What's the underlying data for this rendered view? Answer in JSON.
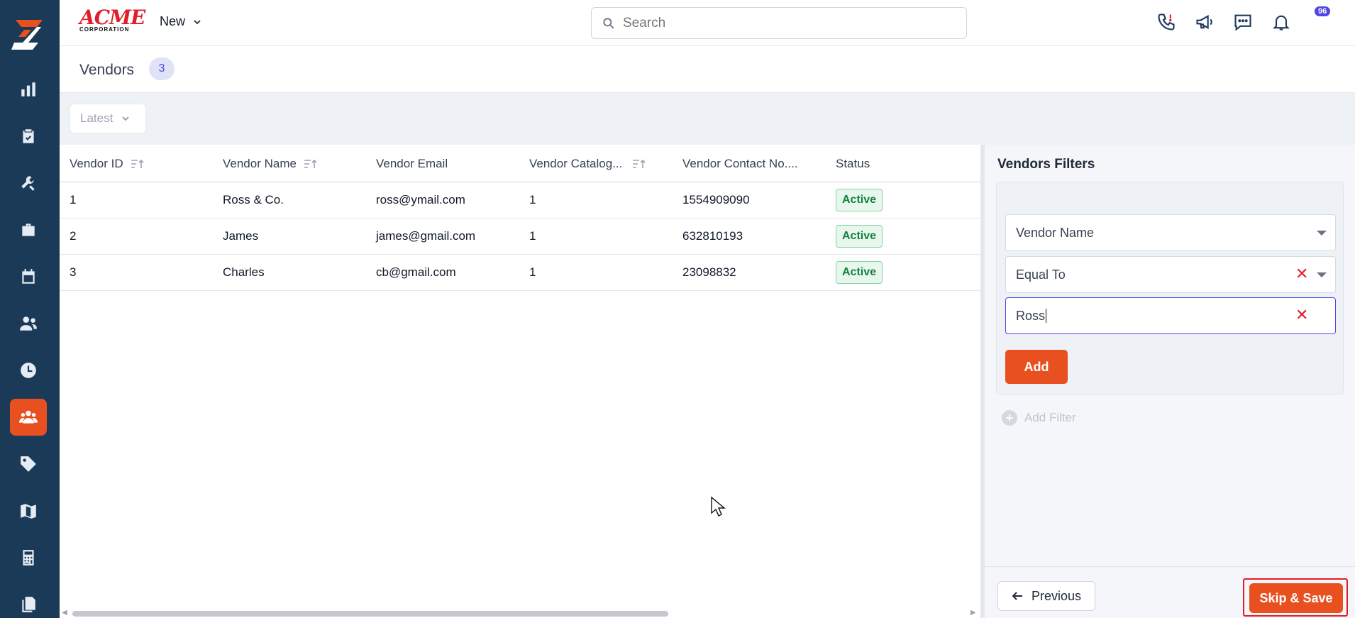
{
  "brand": {
    "name_top": "ACME",
    "name_bottom": "CORPORATION"
  },
  "topbar": {
    "new_label": "New",
    "search_placeholder": "Search",
    "notification_count": "96"
  },
  "page": {
    "title": "Vendors",
    "count": "3"
  },
  "toolbar": {
    "sort_value": "Latest"
  },
  "table": {
    "columns": [
      "Vendor ID",
      "Vendor Name",
      "Vendor Email",
      "Vendor Catalog...",
      "Vendor Contact No....",
      "Status"
    ],
    "rows": [
      {
        "id": "1",
        "name": "Ross & Co.",
        "email": "ross@ymail.com",
        "catalog": "1",
        "contact": "1554909090",
        "status": "Active"
      },
      {
        "id": "2",
        "name": "James",
        "email": "james@gmail.com",
        "catalog": "1",
        "contact": "632810193",
        "status": "Active"
      },
      {
        "id": "3",
        "name": "Charles",
        "email": "cb@gmail.com",
        "catalog": "1",
        "contact": "23098832",
        "status": "Active"
      }
    ]
  },
  "filters": {
    "title": "Vendors Filters",
    "field": "Vendor Name",
    "operator": "Equal To",
    "value": "Ross",
    "add_label": "Add",
    "add_filter_label": "Add Filter",
    "previous_label": "Previous",
    "skip_save_label": "Skip & Save"
  },
  "colors": {
    "accent": "#e8501f",
    "sidebar": "#1b3a57",
    "badge": "#4f46e5",
    "status_green": "#15803d"
  }
}
